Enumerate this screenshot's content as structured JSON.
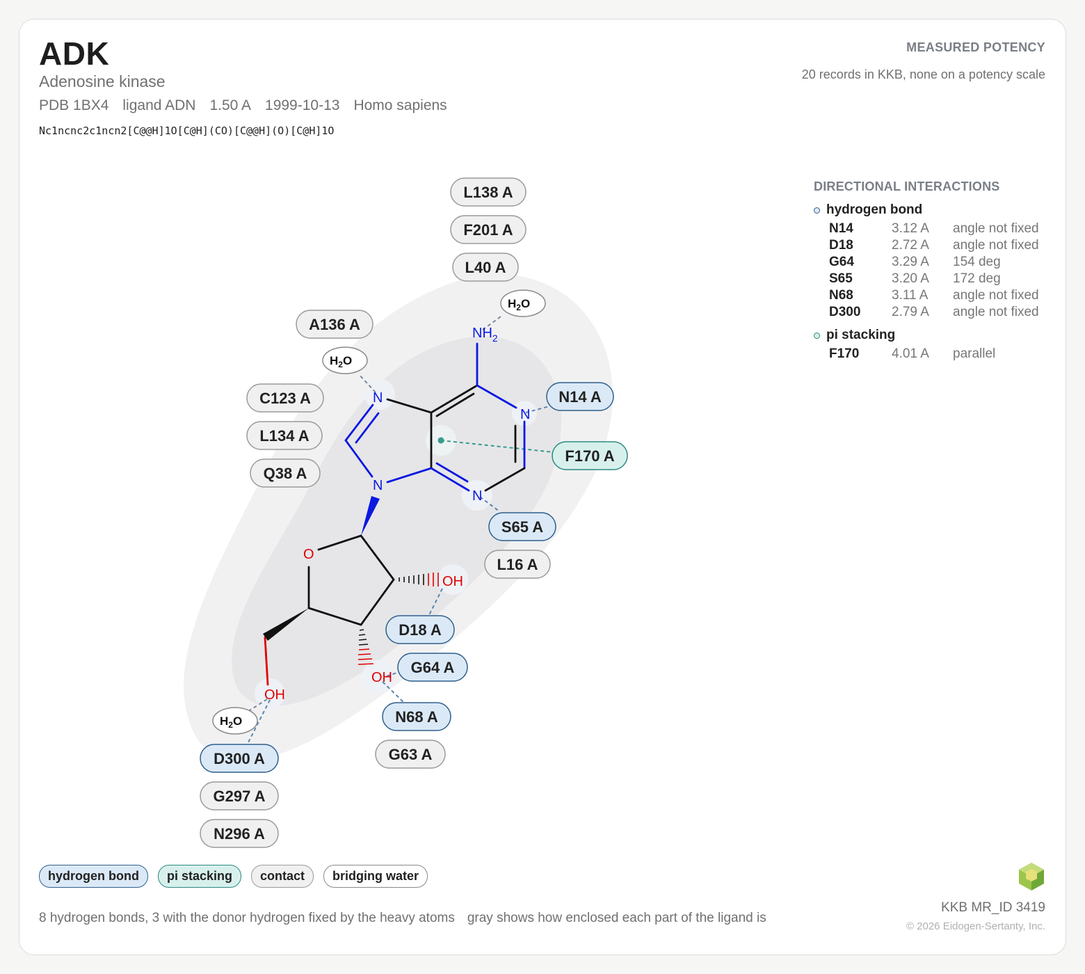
{
  "header": {
    "title": "ADK",
    "subtitle": "Adenosine kinase",
    "pdb": "PDB 1BX4",
    "ligand": "ligand ADN",
    "resolution": "1.50 A",
    "date": "1999-10-13",
    "organism": "Homo sapiens",
    "smiles": "Nc1ncnc2c1ncn2[C@@H]1O[C@H](CO)[C@@H](O)[C@H]1O"
  },
  "potency": {
    "label": "MEASURED POTENCY",
    "text": "20 records in KKB, none on a potency scale"
  },
  "directional": {
    "heading": "DIRECTIONAL INTERACTIONS",
    "hbond_label": "hydrogen bond",
    "hbonds": [
      {
        "res": "N14",
        "dist": "3.12 A",
        "angle": "angle not fixed"
      },
      {
        "res": "D18",
        "dist": "2.72 A",
        "angle": "angle not fixed"
      },
      {
        "res": "G64",
        "dist": "3.29 A",
        "angle": "154 deg"
      },
      {
        "res": "S65",
        "dist": "3.20 A",
        "angle": "172 deg"
      },
      {
        "res": "N68",
        "dist": "3.11 A",
        "angle": "angle not fixed"
      },
      {
        "res": "D300",
        "dist": "2.79 A",
        "angle": "angle not fixed"
      }
    ],
    "pi_label": "pi stacking",
    "pi": [
      {
        "res": "F170",
        "dist": "4.01 A",
        "angle": "parallel"
      }
    ]
  },
  "residues": [
    {
      "id": "L138 A",
      "kind": "contact"
    },
    {
      "id": "F201 A",
      "kind": "contact"
    },
    {
      "id": "L40 A",
      "kind": "contact"
    },
    {
      "id": "A136 A",
      "kind": "contact"
    },
    {
      "id": "C123 A",
      "kind": "contact"
    },
    {
      "id": "L134 A",
      "kind": "contact"
    },
    {
      "id": "Q38 A",
      "kind": "contact"
    },
    {
      "id": "N14 A",
      "kind": "hbond"
    },
    {
      "id": "F170 A",
      "kind": "pi"
    },
    {
      "id": "S65 A",
      "kind": "hbond"
    },
    {
      "id": "L16 A",
      "kind": "contact"
    },
    {
      "id": "D18 A",
      "kind": "hbond"
    },
    {
      "id": "G64 A",
      "kind": "hbond"
    },
    {
      "id": "N68 A",
      "kind": "hbond"
    },
    {
      "id": "G63 A",
      "kind": "contact"
    },
    {
      "id": "D300 A",
      "kind": "hbond"
    },
    {
      "id": "G297 A",
      "kind": "contact"
    },
    {
      "id": "N296 A",
      "kind": "contact"
    }
  ],
  "atoms": {
    "nh2": "NH",
    "nh2_sub": "2",
    "n": "N",
    "o": "O",
    "oh": "OH",
    "water": "H",
    "water_sub": "2",
    "water_o": "O"
  },
  "legend": {
    "hbond": "hydrogen bond",
    "pi": "pi stacking",
    "contact": "contact",
    "water": "bridging water"
  },
  "footer": {
    "note1": "8 hydrogen bonds, 3 with the donor hydrogen fixed by the heavy atoms",
    "note2": "gray shows how enclosed each part of the ligand is",
    "mrid": "KKB MR_ID 3419",
    "copyright": "© 2026 Eidogen-Sertanty, Inc."
  },
  "colors": {
    "hbond_fill": "#dbe9f7",
    "hbond_stroke": "#2f5f8a",
    "pi_fill": "#d8f0ec",
    "pi_stroke": "#2a8a80",
    "contact_fill": "#f0f0f0",
    "contact_stroke": "#9a9a9a",
    "nitrogen": "#0a18e0",
    "oxygen": "#e00000"
  }
}
